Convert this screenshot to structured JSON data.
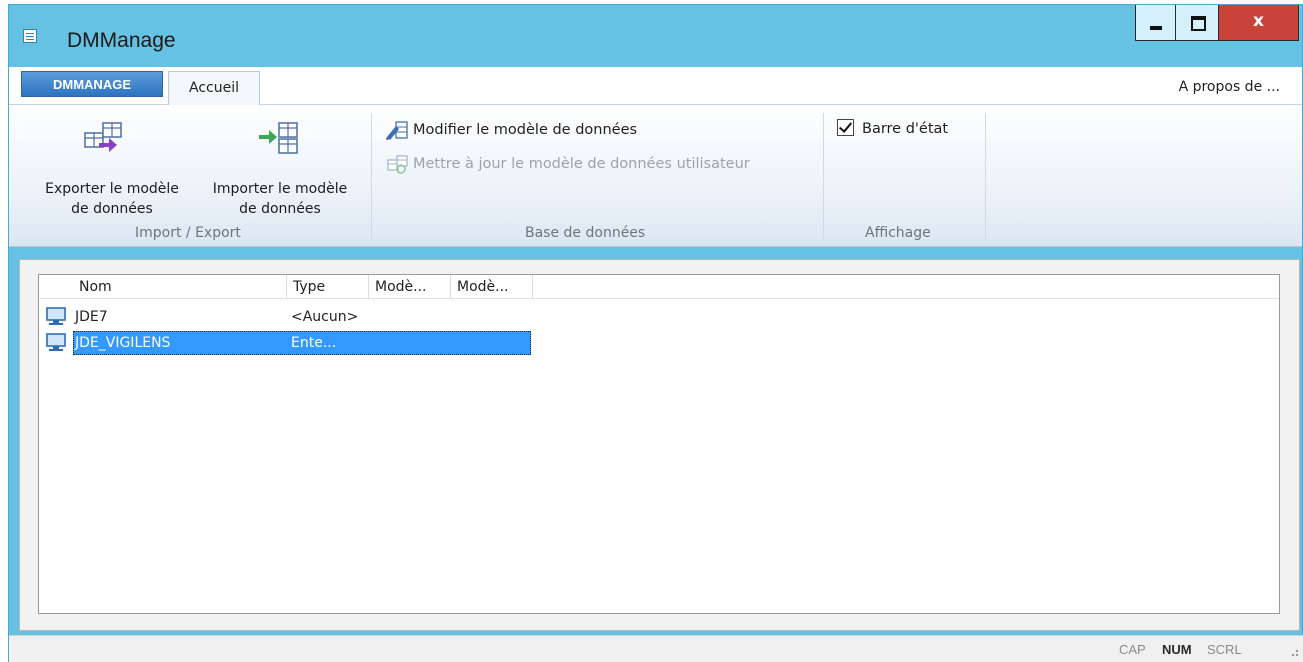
{
  "window": {
    "title": "DMManage"
  },
  "ribbon": {
    "app_tab": "DMMANAGE",
    "tabs": [
      {
        "label": "Accueil",
        "active": true
      }
    ],
    "about": "A propos de ...",
    "groups": {
      "import_export": {
        "label": "Import / Export",
        "export": {
          "line1": "Exporter le modèle",
          "line2": "de données"
        },
        "import": {
          "line1": "Importer le modèle",
          "line2": "de données"
        }
      },
      "database": {
        "label": "Base de données",
        "modify": "Modifier le modèle de données",
        "update": "Mettre à jour le modèle de données utilisateur"
      },
      "display": {
        "label": "Affichage",
        "status_bar": {
          "label": "Barre d'état",
          "checked": true
        }
      }
    }
  },
  "list": {
    "columns": [
      "Nom",
      "Type",
      "Modè...",
      "Modè..."
    ],
    "rows": [
      {
        "name": "JDE7",
        "type": "<Aucun>",
        "selected": false
      },
      {
        "name": "JDE_VIGILENS",
        "type": "Ente...",
        "selected": true
      }
    ]
  },
  "statusbar": {
    "cap": "CAP",
    "num": "NUM",
    "scrl": "SCRL"
  },
  "colors": {
    "titlebar": "#65c2e3",
    "close_button": "#c9433a",
    "selection": "#3399ff",
    "app_tab": "#2e73c0"
  }
}
